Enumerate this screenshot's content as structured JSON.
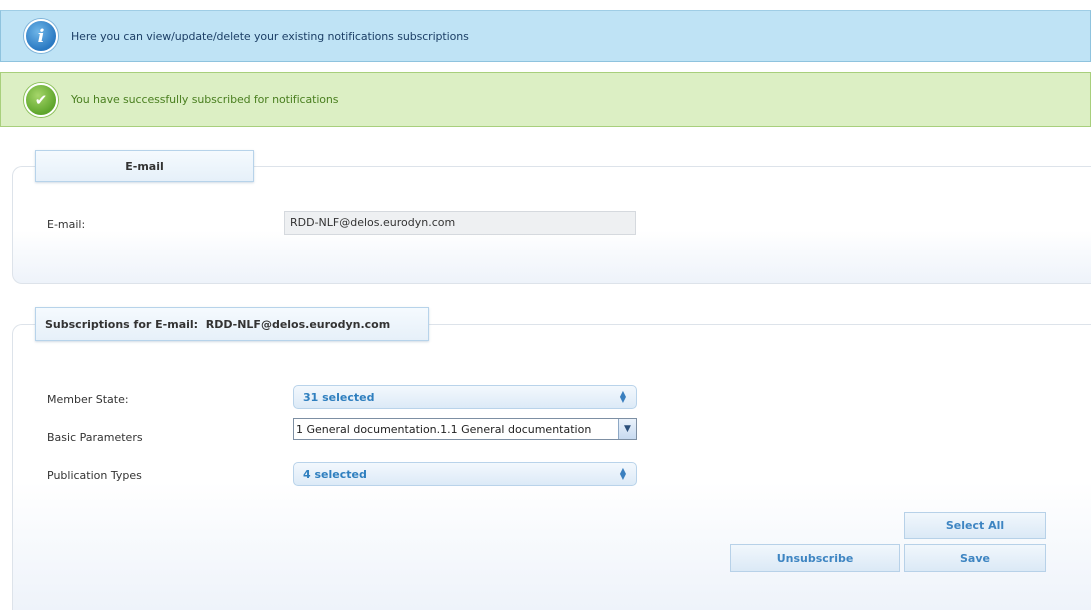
{
  "banners": {
    "info": {
      "icon": "info-icon",
      "text": "Here you can view/update/delete your existing notifications subscriptions"
    },
    "success": {
      "icon": "checkmark-icon",
      "text": "You have successfully subscribed for notifications"
    }
  },
  "email_section": {
    "legend": "E-mail",
    "label": "E-mail:",
    "value": "RDD-NLF@delos.eurodyn.com"
  },
  "subscriptions_section": {
    "legend": "Subscriptions for E-mail:  RDD-NLF@delos.eurodyn.com",
    "fields": {
      "member_state": {
        "label": "Member State:",
        "value": "31 selected"
      },
      "basic_parameters": {
        "label": "Basic Parameters",
        "value": "1 General documentation.1.1 General documentation"
      },
      "publication_types": {
        "label": "Publication Types",
        "value": "4 selected"
      }
    },
    "buttons": {
      "select_all": "Select All",
      "unsubscribe": "Unsubscribe",
      "save": "Save"
    }
  },
  "colors": {
    "info_bg": "#bfe3f5",
    "success_bg": "#dcefc4",
    "accent": "#3e85c2"
  }
}
